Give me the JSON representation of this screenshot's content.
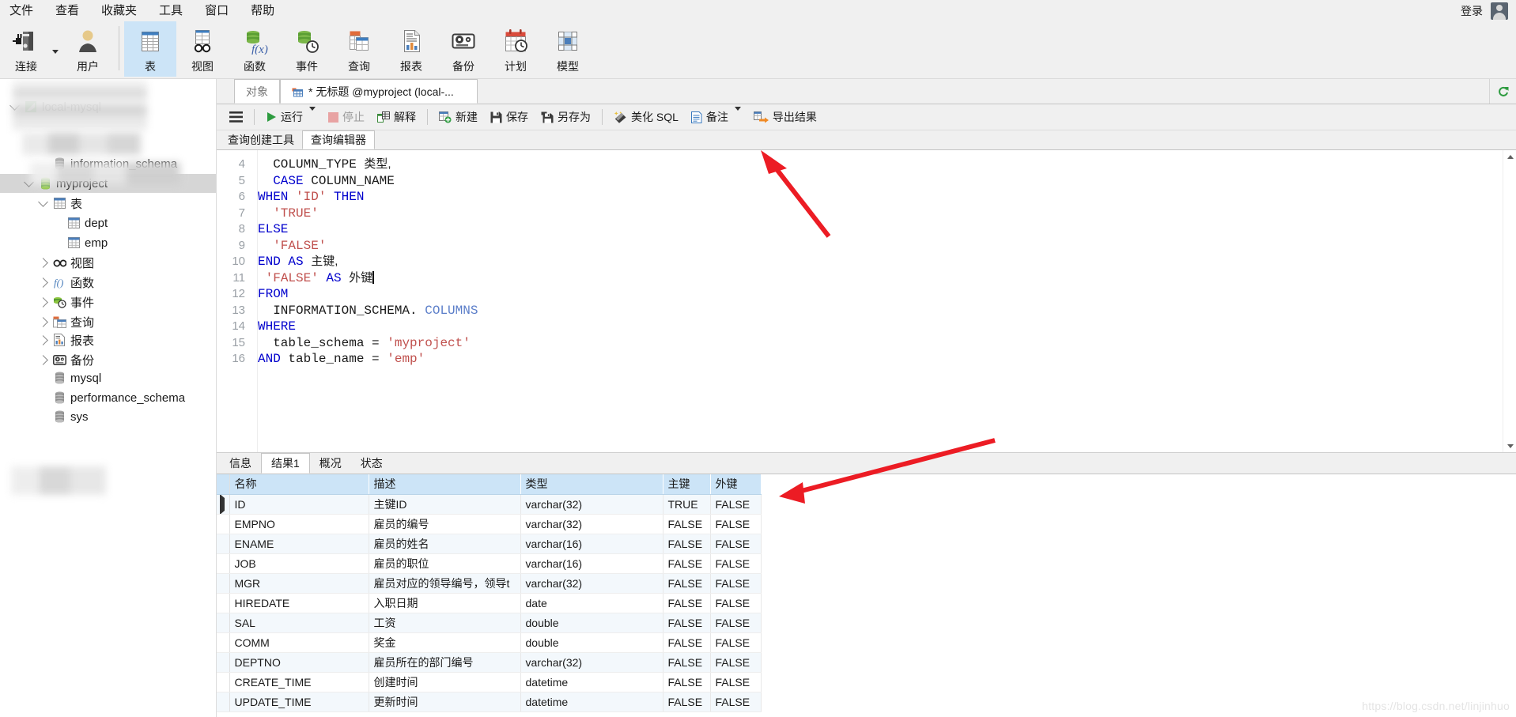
{
  "menubar": {
    "items": [
      {
        "label": "文件",
        "name": "menu-file"
      },
      {
        "label": "查看",
        "name": "menu-view"
      },
      {
        "label": "收藏夹",
        "name": "menu-favorites"
      },
      {
        "label": "工具",
        "name": "menu-tools"
      },
      {
        "label": "窗口",
        "name": "menu-window"
      },
      {
        "label": "帮助",
        "name": "menu-help"
      }
    ],
    "login_label": "登录",
    "avatar_icon": "user-avatar-icon"
  },
  "toolbar": {
    "items": [
      {
        "label": "连接",
        "icon": "connection-icon",
        "active": false
      },
      {
        "label": "用户",
        "icon": "user-icon",
        "active": false
      },
      {
        "label": "表",
        "icon": "table-icon",
        "active": true
      },
      {
        "label": "视图",
        "icon": "view-glasses-icon",
        "active": false
      },
      {
        "label": "函数",
        "icon": "function-icon",
        "active": false
      },
      {
        "label": "事件",
        "icon": "event-clock-icon",
        "active": false
      },
      {
        "label": "查询",
        "icon": "query-icon",
        "active": false
      },
      {
        "label": "报表",
        "icon": "report-icon",
        "active": false
      },
      {
        "label": "备份",
        "icon": "backup-tape-icon",
        "active": false
      },
      {
        "label": "计划",
        "icon": "schedule-calendar-icon",
        "active": false
      },
      {
        "label": "模型",
        "icon": "model-icon",
        "active": false
      }
    ]
  },
  "sidebar": {
    "tree": [
      {
        "label": "local-mysql",
        "icon": "mysql-leaf-icon",
        "depth": 0,
        "twisty": "down",
        "selected": false
      },
      {
        "label": "information_schema",
        "icon": "database-icon",
        "depth": 2,
        "twisty": "none",
        "selected": false
      },
      {
        "label": "myproject",
        "icon": "database-icon",
        "depth": 1,
        "twisty": "down",
        "selected": true
      },
      {
        "label": "表",
        "icon": "table-icon",
        "depth": 2,
        "twisty": "down",
        "selected": false
      },
      {
        "label": "dept",
        "icon": "table-icon",
        "depth": 3,
        "twisty": "none",
        "selected": false
      },
      {
        "label": "emp",
        "icon": "table-icon",
        "depth": 3,
        "twisty": "none",
        "selected": false
      },
      {
        "label": "视图",
        "icon": "view-glasses-icon",
        "depth": 2,
        "twisty": "right",
        "selected": false
      },
      {
        "label": "函数",
        "icon": "function-icon",
        "depth": 2,
        "twisty": "right",
        "selected": false
      },
      {
        "label": "事件",
        "icon": "event-clock-icon",
        "depth": 2,
        "twisty": "right",
        "selected": false
      },
      {
        "label": "查询",
        "icon": "query-icon",
        "depth": 2,
        "twisty": "right",
        "selected": false
      },
      {
        "label": "报表",
        "icon": "report-icon",
        "depth": 2,
        "twisty": "right",
        "selected": false
      },
      {
        "label": "备份",
        "icon": "backup-tape-icon",
        "depth": 2,
        "twisty": "right",
        "selected": false
      },
      {
        "label": "mysql",
        "icon": "database-icon",
        "depth": 2,
        "twisty": "none",
        "selected": false
      },
      {
        "label": "performance_schema",
        "icon": "database-icon",
        "depth": 2,
        "twisty": "none",
        "selected": false
      },
      {
        "label": "sys",
        "icon": "database-icon",
        "depth": 2,
        "twisty": "none",
        "selected": false
      }
    ]
  },
  "tabs": {
    "object_tab": "对象",
    "query_tab": "* 无标题 @myproject (local-...",
    "query_tab_icon": "query-tab-icon",
    "refresh_icon": "refresh-icon"
  },
  "query_toolbar": {
    "menu_icon": "hamburger-menu-icon",
    "items": [
      {
        "label": "运行",
        "icon": "play-icon",
        "dim": false,
        "caret": true
      },
      {
        "label": "停止",
        "icon": "stop-icon",
        "dim": true,
        "caret": false
      },
      {
        "label": "解释",
        "icon": "explain-icon",
        "dim": false,
        "caret": false
      },
      {
        "label": "新建",
        "icon": "new-icon",
        "dim": false,
        "caret": false
      },
      {
        "label": "保存",
        "icon": "save-icon",
        "dim": false,
        "caret": false
      },
      {
        "label": "另存为",
        "icon": "save-as-icon",
        "dim": false,
        "caret": false
      },
      {
        "label": "美化 SQL",
        "icon": "beautify-icon",
        "dim": false,
        "caret": false
      },
      {
        "label": "备注",
        "icon": "comment-icon",
        "dim": false,
        "caret": true
      },
      {
        "label": "导出结果",
        "icon": "export-icon",
        "dim": false,
        "caret": false
      }
    ]
  },
  "editor_tabs": {
    "items": [
      {
        "label": "查询创建工具",
        "active": false
      },
      {
        "label": "查询编辑器",
        "active": true
      }
    ]
  },
  "editor": {
    "lines": [
      {
        "num": "4",
        "tokens": [
          {
            "t": "  ",
            "c": "cn"
          },
          {
            "t": "COLUMN_TYPE ",
            "c": "cn"
          },
          {
            "t": "类型,",
            "c": "zh"
          }
        ]
      },
      {
        "num": "5",
        "tokens": [
          {
            "t": "  ",
            "c": "cn"
          },
          {
            "t": "CASE ",
            "c": "kw"
          },
          {
            "t": "COLUMN_NAME",
            "c": "cn"
          }
        ]
      },
      {
        "num": "6",
        "tokens": [
          {
            "t": "WHEN ",
            "c": "kw"
          },
          {
            "t": "'ID' ",
            "c": "str"
          },
          {
            "t": "THEN",
            "c": "kw"
          }
        ]
      },
      {
        "num": "7",
        "tokens": [
          {
            "t": "  ",
            "c": "cn"
          },
          {
            "t": "'TRUE'",
            "c": "str"
          }
        ]
      },
      {
        "num": "8",
        "tokens": [
          {
            "t": "ELSE",
            "c": "kw"
          }
        ]
      },
      {
        "num": "9",
        "tokens": [
          {
            "t": "  ",
            "c": "cn"
          },
          {
            "t": "'FALSE'",
            "c": "str"
          }
        ]
      },
      {
        "num": "10",
        "tokens": [
          {
            "t": "END AS ",
            "c": "kw"
          },
          {
            "t": "主键,",
            "c": "zh"
          }
        ]
      },
      {
        "num": "11",
        "tokens": [
          {
            "t": " ",
            "c": "cn"
          },
          {
            "t": "'FALSE' ",
            "c": "str"
          },
          {
            "t": "AS ",
            "c": "kw"
          },
          {
            "t": "外键",
            "c": "zh"
          }
        ]
      },
      {
        "num": "12",
        "tokens": [
          {
            "t": "FROM",
            "c": "kw"
          }
        ]
      },
      {
        "num": "13",
        "tokens": [
          {
            "t": "  ",
            "c": "cn"
          },
          {
            "t": "INFORMATION_SCHEMA. ",
            "c": "cn"
          },
          {
            "t": "COLUMNS",
            "c": "fn"
          }
        ]
      },
      {
        "num": "14",
        "tokens": [
          {
            "t": "WHERE",
            "c": "kw"
          }
        ]
      },
      {
        "num": "15",
        "tokens": [
          {
            "t": "  table_schema = ",
            "c": "cn"
          },
          {
            "t": "'myproject'",
            "c": "str"
          }
        ]
      },
      {
        "num": "16",
        "tokens": [
          {
            "t": "AND ",
            "c": "kw"
          },
          {
            "t": "table_name = ",
            "c": "cn"
          },
          {
            "t": "'emp'",
            "c": "str"
          }
        ]
      }
    ]
  },
  "result_tabs": {
    "items": [
      {
        "label": "信息",
        "active": false
      },
      {
        "label": "结果1",
        "active": true
      },
      {
        "label": "概况",
        "active": false
      },
      {
        "label": "状态",
        "active": false
      }
    ]
  },
  "grid": {
    "columns": [
      "名称",
      "描述",
      "类型",
      "主键",
      "外键"
    ],
    "rows": [
      [
        "ID",
        "主键ID",
        "varchar(32)",
        "TRUE",
        "FALSE"
      ],
      [
        "EMPNO",
        "雇员的编号",
        "varchar(32)",
        "FALSE",
        "FALSE"
      ],
      [
        "ENAME",
        "雇员的姓名",
        "varchar(16)",
        "FALSE",
        "FALSE"
      ],
      [
        "JOB",
        "雇员的职位",
        "varchar(16)",
        "FALSE",
        "FALSE"
      ],
      [
        "MGR",
        "雇员对应的领导编号，领导t",
        "varchar(32)",
        "FALSE",
        "FALSE"
      ],
      [
        "HIREDATE",
        "入职日期",
        "date",
        "FALSE",
        "FALSE"
      ],
      [
        "SAL",
        "工资",
        "double",
        "FALSE",
        "FALSE"
      ],
      [
        "COMM",
        "奖金",
        "double",
        "FALSE",
        "FALSE"
      ],
      [
        "DEPTNO",
        "雇员所在的部门编号",
        "varchar(32)",
        "FALSE",
        "FALSE"
      ],
      [
        "CREATE_TIME",
        "创建时间",
        "datetime",
        "FALSE",
        "FALSE"
      ],
      [
        "UPDATE_TIME",
        "更新时间",
        "datetime",
        "FALSE",
        "FALSE"
      ]
    ],
    "selected_row_index": 0
  },
  "watermark": "https://blog.csdn.net/linjinhuo",
  "colors": {
    "accent": "#cce4f7",
    "keyword": "#0000cd",
    "string": "#c0504d",
    "annotation_arrow": "#ec1c24"
  }
}
